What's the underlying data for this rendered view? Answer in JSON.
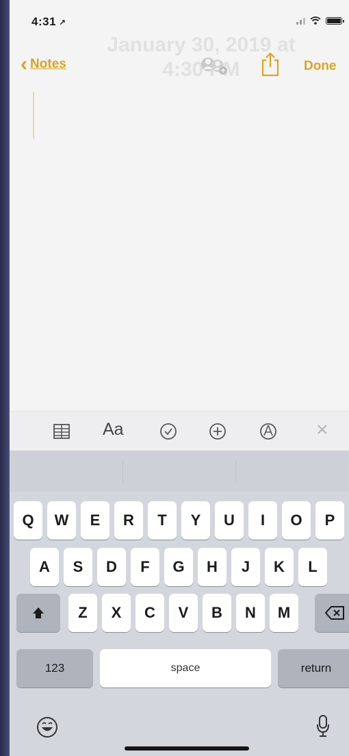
{
  "status": {
    "time": "4:31",
    "location_glyph": "↗"
  },
  "nav": {
    "back_chevron": "‹",
    "back_label": "Notes",
    "done_label": "Done",
    "ghost_line1": "January 30, 2019 at",
    "ghost_line2": "4:30 PM"
  },
  "toolbar": {
    "table_icon": "table-icon",
    "format_label": "Aa",
    "checklist_icon": "checklist-icon",
    "add_icon": "add-icon",
    "markup_icon": "markup-icon",
    "close_glyph": "×"
  },
  "keyboard": {
    "row1": [
      "Q",
      "W",
      "E",
      "R",
      "T",
      "Y",
      "U",
      "I",
      "O",
      "P"
    ],
    "row2": [
      "A",
      "S",
      "D",
      "F",
      "G",
      "H",
      "J",
      "K",
      "L"
    ],
    "row3": [
      "Z",
      "X",
      "C",
      "V",
      "B",
      "N",
      "M"
    ],
    "numbers_label": "123",
    "space_label": "space",
    "return_label": "return"
  },
  "colors": {
    "accent": "#d9a427",
    "key": "#ffffff",
    "keyboard_bg": "#d3d6dc"
  }
}
